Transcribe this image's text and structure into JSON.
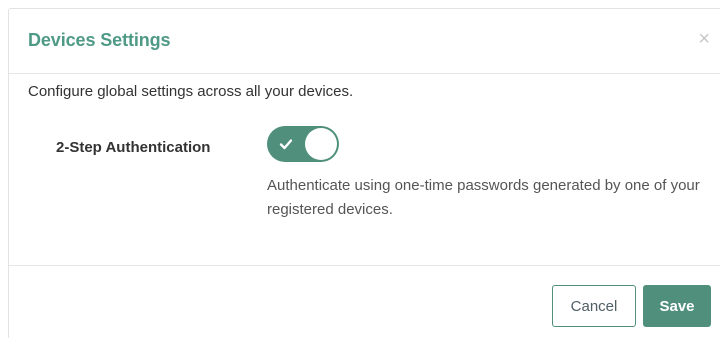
{
  "modal": {
    "title": "Devices Settings",
    "close_symbol": "×",
    "description": "Configure global settings across all your devices."
  },
  "setting": {
    "label": "2-Step Authentication",
    "enabled": true,
    "help_text": "Authenticate using one-time passwords generated by one of your registered devices."
  },
  "footer": {
    "cancel_label": "Cancel",
    "save_label": "Save"
  },
  "colors": {
    "accent": "#4f8f7b",
    "title": "#4f9a86"
  },
  "icons": {
    "close": "close-icon",
    "toggle_check": "check-icon"
  }
}
